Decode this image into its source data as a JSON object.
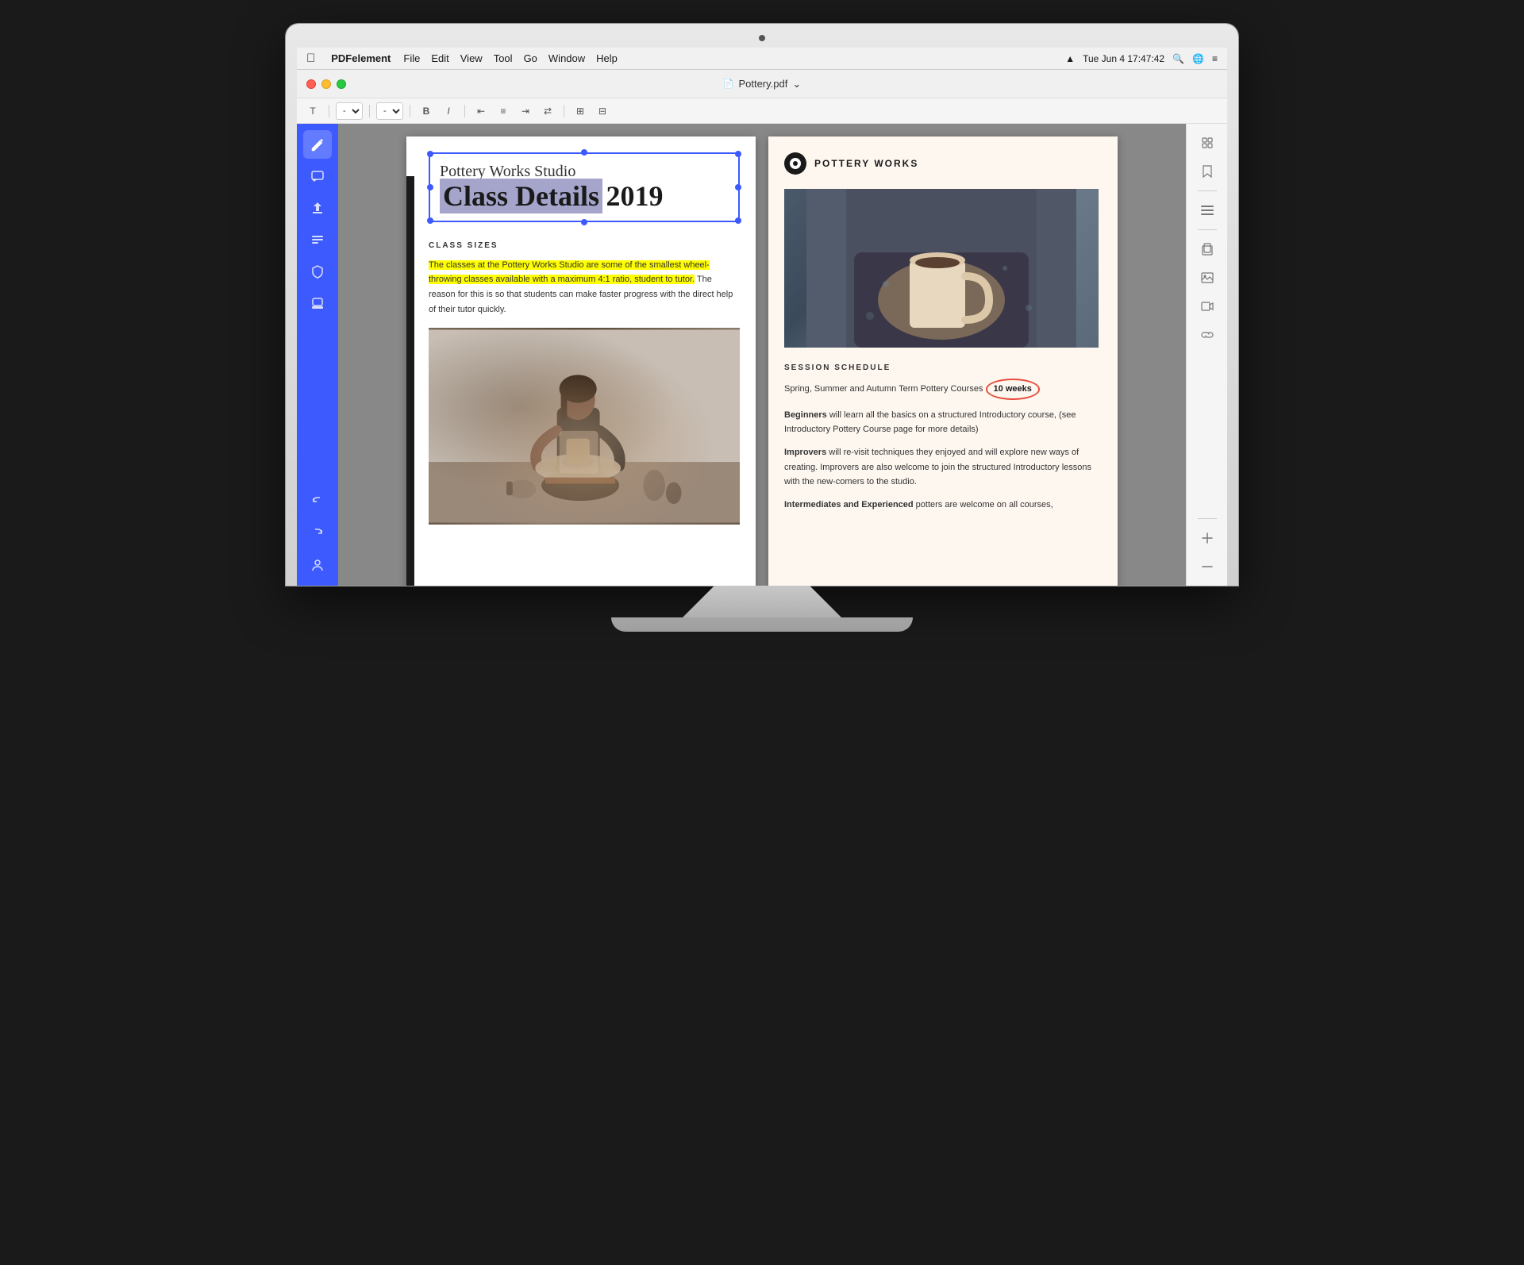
{
  "os": {
    "apple_label": "",
    "app_name": "PDFelement",
    "menu_items": [
      "File",
      "Edit",
      "View",
      "Tool",
      "Go",
      "Window",
      "Help"
    ],
    "time": "Tue Jun 4  17:47:42",
    "title_bar": "Pottery.pdf"
  },
  "toolbar": {
    "text_tool": "T",
    "font_placeholder": "-",
    "size_placeholder": "-"
  },
  "sidebar_left": {
    "icons": [
      {
        "name": "edit-icon",
        "symbol": "✏️",
        "active": true
      },
      {
        "name": "comment-icon",
        "symbol": "💬",
        "active": false
      },
      {
        "name": "share-icon",
        "symbol": "✈",
        "active": false
      },
      {
        "name": "form-icon",
        "symbol": "☰",
        "active": false
      },
      {
        "name": "protect-icon",
        "symbol": "⌂",
        "active": false
      },
      {
        "name": "stamp-icon",
        "symbol": "⊡",
        "active": false
      }
    ],
    "bottom_icons": [
      {
        "name": "undo-icon",
        "symbol": "↩"
      },
      {
        "name": "redo-icon",
        "symbol": "↪"
      },
      {
        "name": "user-icon",
        "symbol": "👤"
      }
    ]
  },
  "page_left": {
    "title_line1": "Pottery Works Studio",
    "title_line2": "Class Details",
    "title_year": "2019",
    "class_sizes_heading": "CLASS SIZES",
    "class_sizes_text_highlighted": "The classes at the Pottery Works Studio are some of the smallest wheel-throwing classes available with a maximum 4:1 ratio, student to tutor.",
    "class_sizes_text_normal": " The reason for this is so that students can make faster progress with the direct help of their tutor quickly."
  },
  "page_right": {
    "logo_text": "POTTERY WORKS",
    "session_heading": "SESSION SCHEDULE",
    "session_intro": "Spring, Summer and Autumn Term Pottery Courses",
    "weeks_badge": "10 weeks",
    "beginners_bold": "Beginners",
    "beginners_text": " will learn all the basics on a structured Introductory course, (see Introductory Pottery Course page for more details)",
    "improvers_bold": "Improvers",
    "improvers_text": " will re-visit techniques they enjoyed and will explore new ways of creating. Improvers are also welcome to join the structured Introductory lessons with the new-comers to the studio.",
    "intermediates_bold": "Intermediates and Experienced",
    "intermediates_text": " potters are welcome on all courses,"
  },
  "sidebar_right": {
    "icons": [
      {
        "name": "pages-icon",
        "symbol": "⊞"
      },
      {
        "name": "bookmark-icon",
        "symbol": "🔖"
      },
      {
        "name": "menu-icon",
        "symbol": "≡"
      },
      {
        "name": "attachment-icon",
        "symbol": "📎"
      },
      {
        "name": "image-icon",
        "symbol": "🖼"
      },
      {
        "name": "video-icon",
        "symbol": "▶"
      },
      {
        "name": "link-icon",
        "symbol": "🔗"
      }
    ]
  },
  "colors": {
    "sidebar_blue": "#3d5afe",
    "highlight_yellow": "#ffff00",
    "title_selection": "#a5a5cc",
    "title_border": "#3d5afe",
    "badge_circle": "#e74c3c",
    "page_right_bg": "#fef7f0"
  }
}
